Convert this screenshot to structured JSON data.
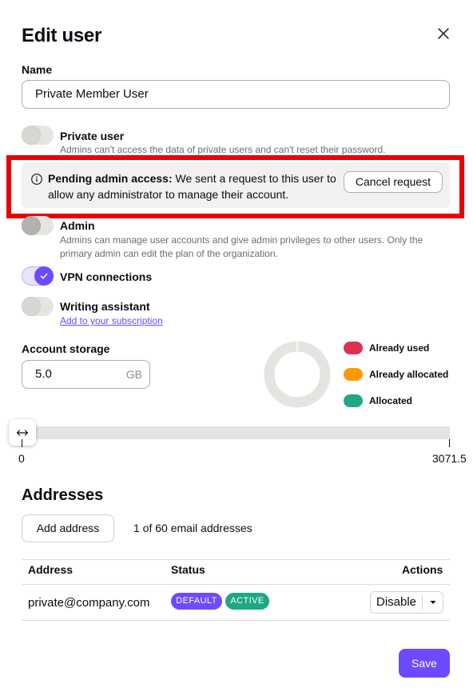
{
  "modal": {
    "title": "Edit user"
  },
  "name_field": {
    "label": "Name",
    "value": "Private Member User"
  },
  "private_user": {
    "title": "Private user",
    "description": "Admins can't access the data of private users and can't reset their password.",
    "enabled": false
  },
  "pending_notice": {
    "bold": "Pending admin access:",
    "text": "We sent a request to this user to allow any administrator to manage their account.",
    "cancel_label": "Cancel request"
  },
  "admin": {
    "title": "Admin",
    "description": "Admins can manage user accounts and give admin privileges to other users. Only the primary admin can edit the plan of the organization.",
    "enabled": false
  },
  "vpn": {
    "title": "VPN connections",
    "enabled": true
  },
  "writing_assistant": {
    "title": "Writing assistant",
    "link": "Add to your subscription",
    "enabled": false
  },
  "storage": {
    "label": "Account storage",
    "value": "5.0",
    "unit": "GB",
    "min_label": "0",
    "max_label": "3071.5",
    "legend": [
      {
        "label": "Already used",
        "color": "#dc3251"
      },
      {
        "label": "Already allocated",
        "color": "#ff9900"
      },
      {
        "label": "Allocated",
        "color": "#1ea885"
      }
    ],
    "track_color": "#e5e4e1",
    "expand_icon": "horizontal-arrows-icon"
  },
  "addresses": {
    "title": "Addresses",
    "add_label": "Add address",
    "count_text": "1 of 60 email addresses",
    "columns": {
      "address": "Address",
      "status": "Status",
      "actions": "Actions"
    },
    "rows": [
      {
        "address": "private@company.com",
        "badges": [
          {
            "label": "DEFAULT",
            "color": "#6d4aff"
          },
          {
            "label": "ACTIVE",
            "color": "#1ea885"
          }
        ],
        "action_label": "Disable"
      }
    ]
  },
  "footer": {
    "save_label": "Save"
  },
  "colors": {
    "accent": "#6d4aff",
    "highlight_border": "#ea0000"
  }
}
